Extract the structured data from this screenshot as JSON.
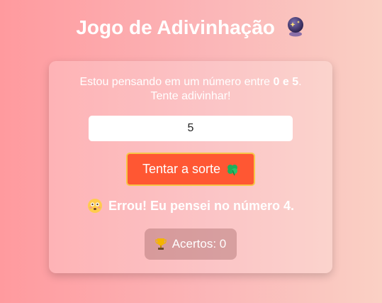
{
  "title": "Jogo de Adivinhação",
  "title_icon": "crystal-ball-icon",
  "intro": {
    "part1": "Estou pensando em um número entre ",
    "min": "0",
    "and": " e ",
    "max": "5",
    "part2": ".",
    "line2": "Tente adivinhar!"
  },
  "guess_input": {
    "value": "5",
    "placeholder": ""
  },
  "guess_button": {
    "label": "Tentar a sorte",
    "icon": "four-leaf-clover-icon"
  },
  "result": {
    "text": "Errou! Eu pensei no número 4.",
    "icon": "flushed-face-icon"
  },
  "score": {
    "label": "Acertos: 0",
    "icon": "trophy-icon"
  },
  "colors": {
    "background_start": "#ff9a9e",
    "background_end": "#fad0c4",
    "button": "#ff5733",
    "button_border": "#f7c548"
  }
}
